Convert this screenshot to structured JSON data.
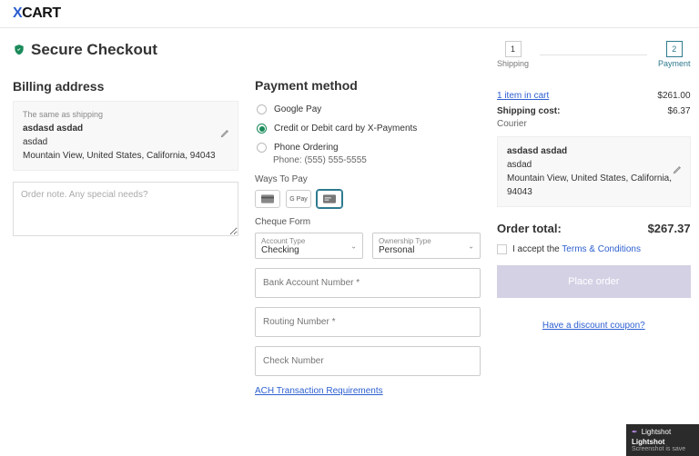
{
  "logo": {
    "x": "X",
    "rest": "CART"
  },
  "title": "Secure Checkout",
  "steps": {
    "s1_num": "1",
    "s1_lbl": "Shipping",
    "s2_num": "2",
    "s2_lbl": "Payment"
  },
  "billing": {
    "heading": "Billing address",
    "same": "The same as shipping",
    "name": "asdasd asdad",
    "company": "asdad",
    "addr": "Mountain View, United States, California, 94043",
    "note_ph": "Order note. Any special needs?"
  },
  "payment": {
    "heading": "Payment method",
    "gpay": "Google Pay",
    "xpay": "Credit or Debit card by X-Payments",
    "phone": "Phone Ordering",
    "phone_sub": "Phone: (555) 555-5555",
    "ways_h": "Ways To Pay",
    "gpay_tile": "G Pay",
    "cheque_h": "Cheque Form",
    "acct_lbl": "Account Type",
    "acct_val": "Checking",
    "own_lbl": "Ownership Type",
    "own_val": "Personal",
    "bank_ph": "Bank Account Number *",
    "route_ph": "Routing Number *",
    "check_ph": "Check Number",
    "ach": "ACH Transaction Requirements"
  },
  "summary": {
    "cart_link": "1 item in cart",
    "cart_total": "$261.00",
    "ship_lbl": "Shipping cost:",
    "ship_val": "$6.37",
    "courier": "Courier",
    "ship_name": "asdasd asdad",
    "ship_company": "asdad",
    "ship_addr": "Mountain View, United States, California, 94043",
    "total_lbl": "Order total:",
    "total_val": "$267.37",
    "terms_pre": "I accept the ",
    "terms_link": "Terms & Conditions",
    "place": "Place order",
    "coupon": "Have a discount coupon?"
  },
  "lightshot": {
    "name": "Lightshot",
    "sub": "Screenshot is save"
  }
}
